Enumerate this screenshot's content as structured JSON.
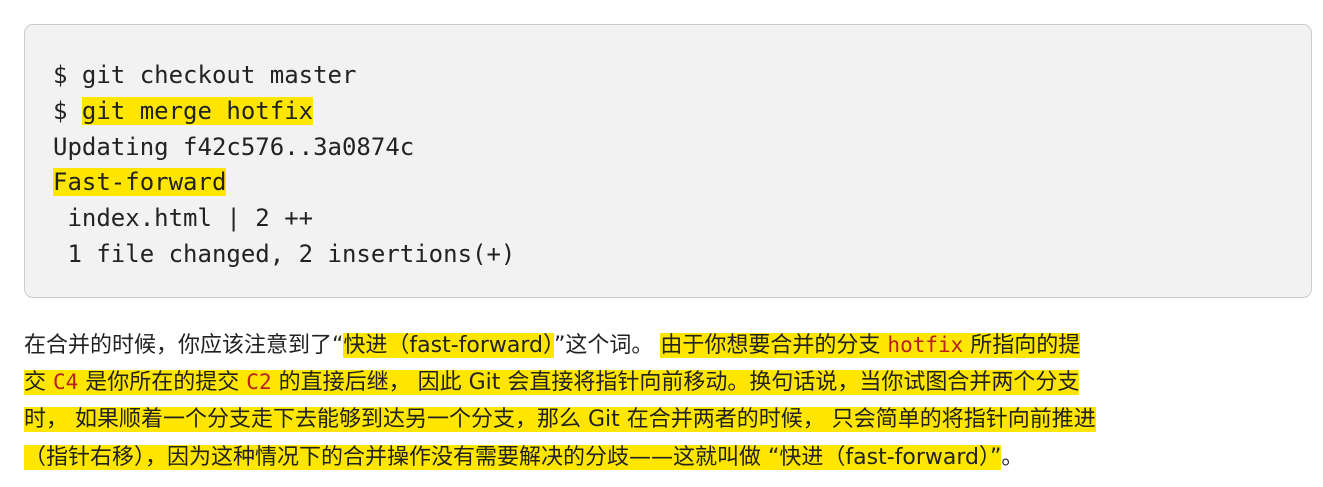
{
  "code": {
    "line1": "$ git checkout master",
    "line2_prompt": "$ ",
    "line2_cmd": "git merge hotfix",
    "line3": "Updating f42c576..3a0874c",
    "line4": "Fast-forward",
    "line5": " index.html | 2 ++",
    "line6": " 1 file changed, 2 insertions(+)"
  },
  "paragraph": {
    "l1_a": "在合并的时候，你应该注意到了“",
    "l1_b": "快进（fast-forward）",
    "l1_c": "”这个词。 ",
    "l1_d": "由于你想要合并的分支 ",
    "l1_e": "hotfix",
    "l1_f": " 所指向的提",
    "l2_a": "交 ",
    "l2_b": "C4",
    "l2_c": " 是你所在的提交 ",
    "l2_d": "C2",
    "l2_e": " 的直接后继， 因此 Git 会直接将指针向前移动。换句话说，当你试图合并两个分支",
    "l3": "时， 如果顺着一个分支走下去能够到达另一个分支，那么 Git 在合并两者的时候， 只会简单的将指针向前推进",
    "l4_a": "（指针右移），因为这种情况下的合并操作没有需要解决的分歧——这就叫做 “快进（fast-forward）”",
    "l4_b": "。"
  },
  "colors": {
    "highlight": "#ffe600",
    "code_bg": "#f2f2f2",
    "inline_code": "#b82020"
  }
}
